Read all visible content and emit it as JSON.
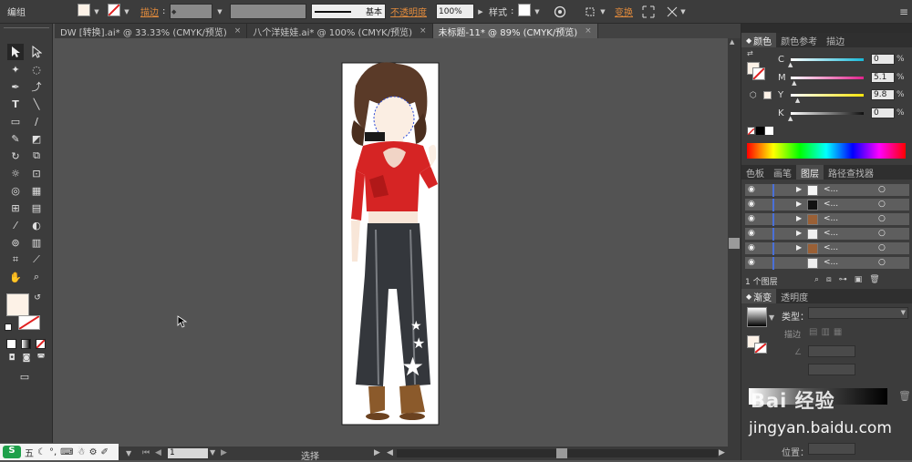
{
  "control_bar": {
    "selection_label": "编组",
    "stroke_label": "描边",
    "stroke_style": "基本",
    "opacity_label": "不透明度",
    "opacity_value": "100%",
    "style_label": "样式",
    "transform_label": "变换"
  },
  "tabs": [
    {
      "label": "DW [转换].ai* @ 33.33% (CMYK/预览)",
      "close": "×"
    },
    {
      "label": "八个洋娃娃.ai* @ 100% (CMYK/预览)",
      "close": "×"
    },
    {
      "label": "未标题-11* @ 89% (CMYK/预览)",
      "close": "×"
    }
  ],
  "color_panel": {
    "tabs": [
      "颜色",
      "颜色参考",
      "描边"
    ],
    "channels": [
      {
        "label": "C",
        "value": "0",
        "fill": 0.0,
        "color": "#19b9d8"
      },
      {
        "label": "M",
        "value": "5.1",
        "fill": 0.051,
        "color": "#e0228c"
      },
      {
        "label": "Y",
        "value": "9.8",
        "fill": 0.098,
        "color": "#f6e40c"
      },
      {
        "label": "K",
        "value": "0",
        "fill": 0.0,
        "color": "#111111"
      }
    ],
    "fill_color": "#fdf2e7"
  },
  "layers_panel": {
    "tabs": [
      "色板",
      "画笔",
      "图层",
      "路径查找器"
    ],
    "rows": 6,
    "count_label": "1 个图层"
  },
  "gradient_panel": {
    "tabs": [
      "渐变",
      "透明度"
    ],
    "type_label": "类型：",
    "stroke_label": "描边",
    "position_label": "位置："
  },
  "watermark": {
    "line1": "Bai 经验",
    "line2": "jingyan.baidu.com"
  },
  "status_bar": {
    "page": "1",
    "tool_label": "选择"
  },
  "ime": {
    "mode": "五"
  }
}
